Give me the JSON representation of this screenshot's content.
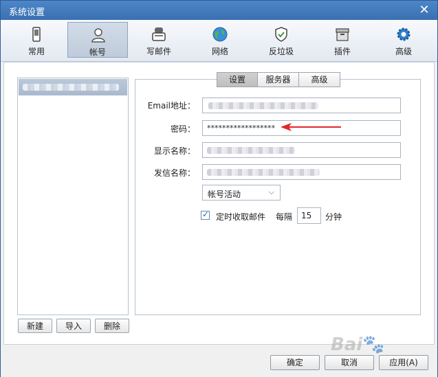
{
  "window": {
    "title": "系统设置"
  },
  "toolbar": {
    "items": [
      {
        "label": "常用",
        "icon": "phone-icon"
      },
      {
        "label": "帐号",
        "icon": "user-icon",
        "active": true
      },
      {
        "label": "写邮件",
        "icon": "compose-icon"
      },
      {
        "label": "网络",
        "icon": "globe-icon"
      },
      {
        "label": "反垃圾",
        "icon": "shield-icon"
      },
      {
        "label": "插件",
        "icon": "box-icon"
      },
      {
        "label": "高级",
        "icon": "gear-icon"
      }
    ]
  },
  "accounts": {
    "new_label": "新建",
    "import_label": "导入",
    "delete_label": "删除"
  },
  "subtabs": {
    "settings": "设置",
    "server": "服务器",
    "advanced": "高级",
    "active": "设置"
  },
  "form": {
    "email_label": "Email地址：",
    "password_label": "密码：",
    "password_value": "******************",
    "display_name_label": "显示名称：",
    "sender_name_label": "发信名称：",
    "account_status": "帐号活动",
    "auto_receive_label": "定时收取邮件",
    "auto_receive_checked": true,
    "interval_prefix": "每隔",
    "interval_value": "15",
    "interval_unit": "分钟"
  },
  "footer": {
    "ok_label": "确定",
    "cancel_label": "取消",
    "apply_label": "应用(A)"
  },
  "colors": {
    "title_bar": "#3a70b1",
    "arrow": "#e3262b",
    "selected_account": "#b0c0d4"
  }
}
